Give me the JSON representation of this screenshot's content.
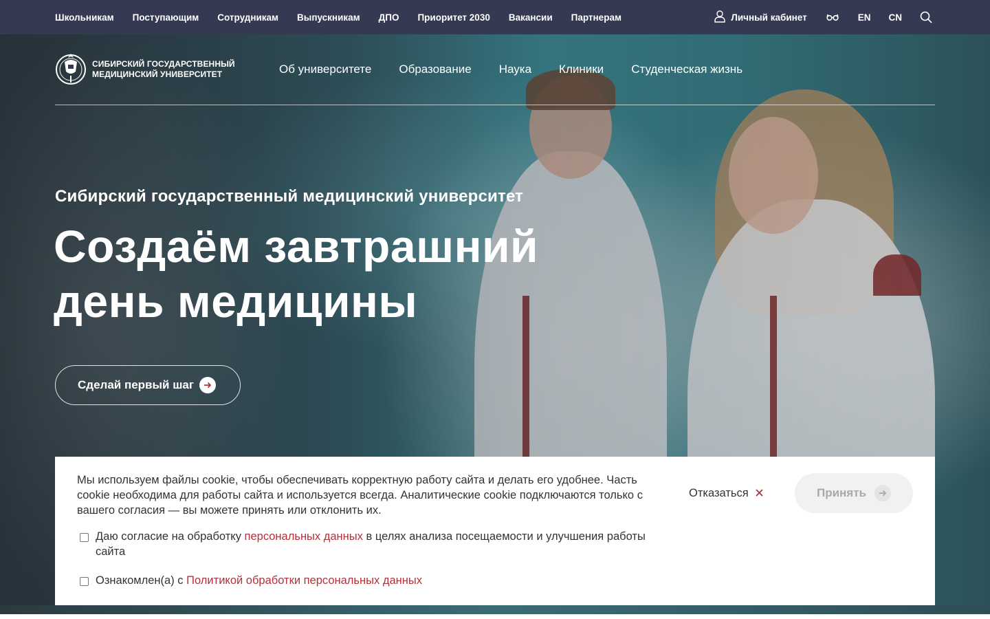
{
  "topbar": {
    "links": [
      "Школьникам",
      "Поступающим",
      "Сотрудникам",
      "Выпускникам",
      "ДПО",
      "Приоритет 2030",
      "Вакансии",
      "Партнерам"
    ],
    "cabinet_label": "Личный кабинет",
    "lang_en": "EN",
    "lang_cn": "CN",
    "icons": [
      "user-icon",
      "glasses-icon",
      "search-icon"
    ]
  },
  "header": {
    "logo_line1": "Сибирский государственный",
    "logo_line2": "медицинский университет",
    "nav": [
      "Об университете",
      "Образование",
      "Наука",
      "Клиники",
      "Студенческая жизнь"
    ]
  },
  "hero": {
    "subtitle": "Сибирский государственный медицинский университет",
    "title_line1": "Создаём завтрашний",
    "title_line2": "день медицины",
    "cta_label": "Сделай первый шаг"
  },
  "cookie": {
    "text": "Мы используем файлы cookie, чтобы обеспечивать корректную работу сайта и делать его удобнее. Часть cookie необходима для работы сайта и используется всегда. Аналитические cookie подключаются только с вашего согласия — вы можете принять или отклонить их.",
    "consent1_before": "Даю согласие на обработку ",
    "consent1_link": "персональных данных",
    "consent1_after": " в целях анализа посещаемости и улучшения работы сайта",
    "consent2_before": "Ознакомлен(а) с ",
    "consent2_link": "Политикой обработки персональных данных",
    "decline_label": "Отказаться",
    "accept_label": "Принять",
    "consent1_checked": false,
    "consent2_checked": false
  },
  "colors": {
    "topbar_bg": "#353a52",
    "link_accent": "#b0323a",
    "accept_disabled_bg": "#f1f1f1"
  }
}
